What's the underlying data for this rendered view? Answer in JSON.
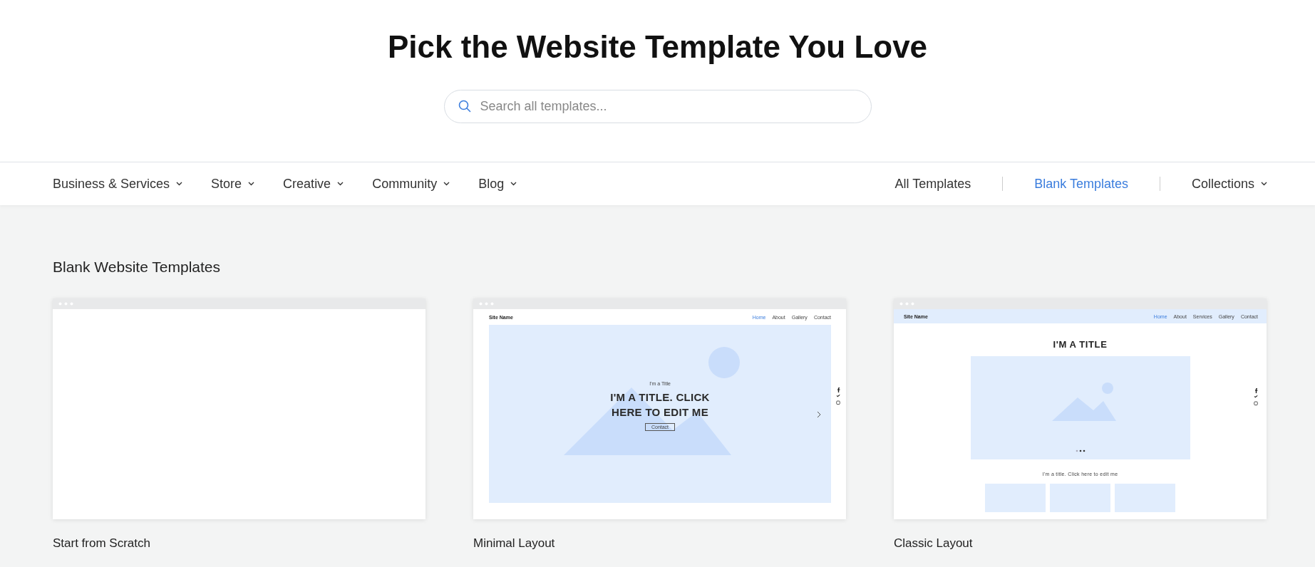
{
  "header": {
    "title": "Pick the Website Template You Love",
    "search": {
      "placeholder": "Search all templates..."
    }
  },
  "nav": {
    "categories": [
      {
        "label": "Business & Services"
      },
      {
        "label": "Store"
      },
      {
        "label": "Creative"
      },
      {
        "label": "Community"
      },
      {
        "label": "Blog"
      }
    ],
    "links": [
      {
        "label": "All Templates",
        "kind": "link",
        "selected": false
      },
      {
        "label": "Blank Templates",
        "kind": "link",
        "selected": true
      },
      {
        "label": "Collections",
        "kind": "dropdown",
        "selected": false
      }
    ]
  },
  "section": {
    "title": "Blank Website Templates",
    "templates": [
      {
        "kind": "blank",
        "name": "Start from Scratch"
      },
      {
        "kind": "minimal",
        "name": "Minimal Layout",
        "site_name": "Site Name",
        "nav_links": [
          {
            "label": "Home",
            "selected": true
          },
          {
            "label": "About",
            "selected": false
          },
          {
            "label": "Gallery",
            "selected": false
          },
          {
            "label": "Contact",
            "selected": false
          }
        ],
        "subtitle": "I'm a Title",
        "headline": "I'M A TITLE. CLICK HERE TO EDIT ME",
        "button": "Contact"
      },
      {
        "kind": "classic",
        "name": "Classic Layout",
        "site_name": "Site Name",
        "nav_links": [
          {
            "label": "Home",
            "selected": true
          },
          {
            "label": "About",
            "selected": false
          },
          {
            "label": "Services",
            "selected": false
          },
          {
            "label": "Gallery",
            "selected": false
          },
          {
            "label": "Contact",
            "selected": false
          }
        ],
        "title": "I'M A TITLE",
        "caption": "I'm a title. Click here to edit me"
      }
    ]
  }
}
